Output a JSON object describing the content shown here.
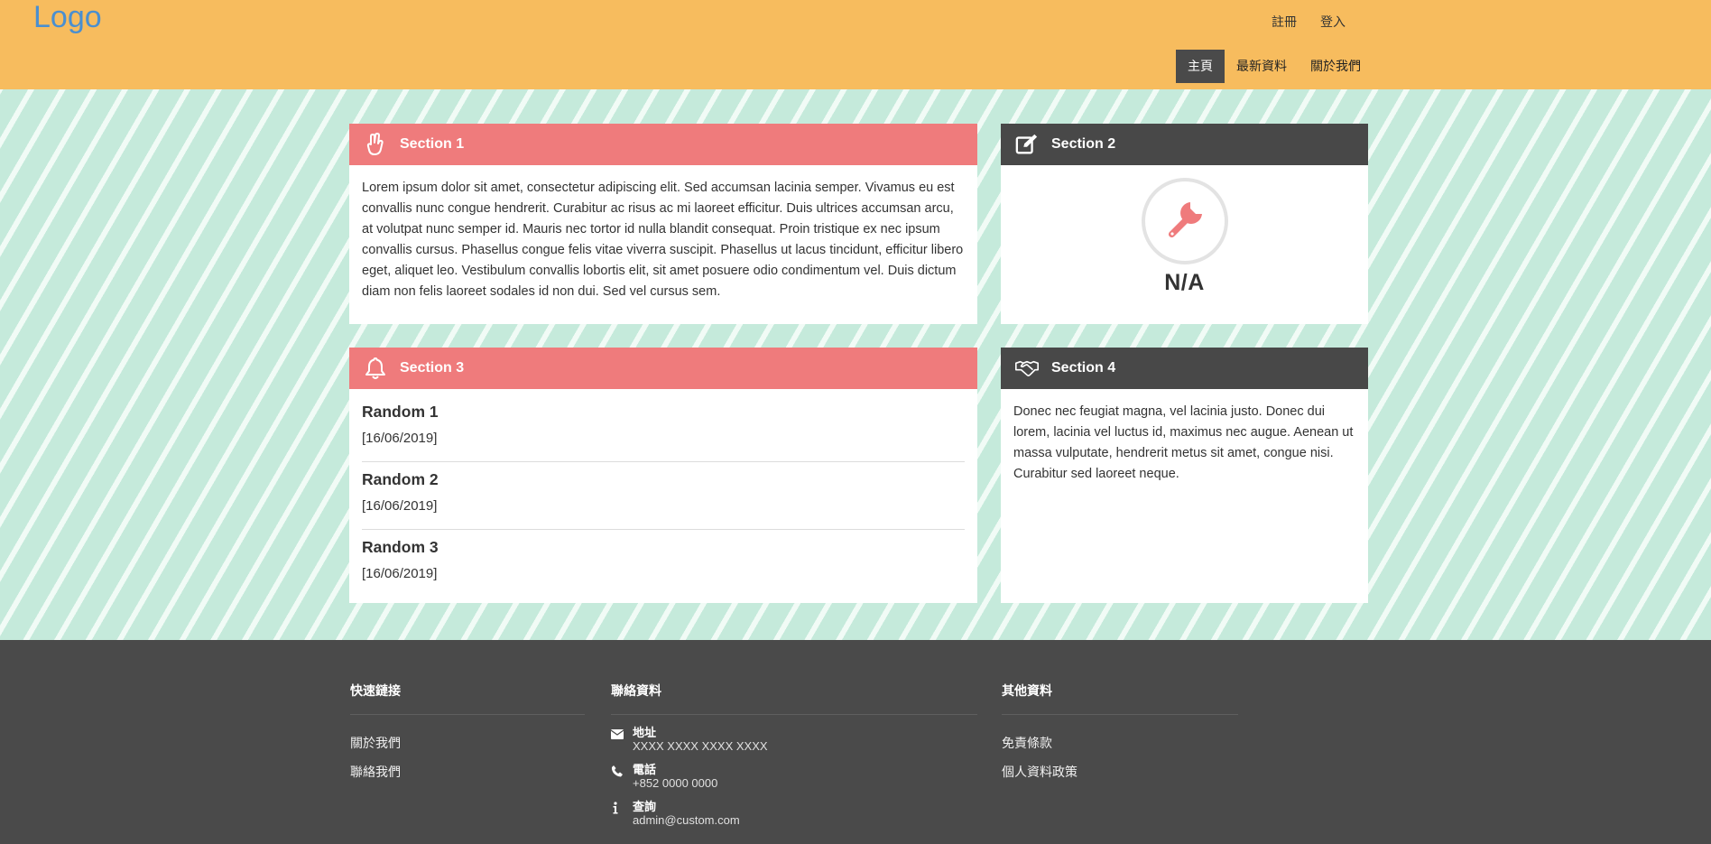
{
  "header": {
    "logo": "Logo",
    "top_links": [
      "註冊",
      "登入"
    ],
    "nav": [
      {
        "label": "主頁",
        "active": true
      },
      {
        "label": "最新資料",
        "active": false
      },
      {
        "label": "關於我們",
        "active": false
      }
    ]
  },
  "sections": {
    "s1": {
      "title": "Section 1",
      "icon": "hand-peace-icon",
      "body": "Lorem ipsum dolor sit amet, consectetur adipiscing elit. Sed accumsan lacinia semper. Vivamus eu est convallis nunc congue hendrerit. Curabitur ac risus ac mi laoreet efficitur. Duis ultrices accumsan arcu, at volutpat nunc semper id. Mauris nec tortor id nulla blandit consequat. Proin tristique ex nec ipsum convallis cursus. Phasellus congue felis vitae viverra suscipit. Phasellus ut lacus tincidunt, efficitur libero eget, aliquet leo. Vestibulum convallis lobortis elit, sit amet posuere odio condimentum vel. Duis dictum diam non felis laoreet sodales id non dui. Sed vel cursus sem."
    },
    "s2": {
      "title": "Section 2",
      "icon": "edit-icon",
      "status_icon": "wrench-icon",
      "value": "N/A"
    },
    "s3": {
      "title": "Section 3",
      "icon": "bell-icon",
      "items": [
        {
          "title": "Random 1",
          "date": "[16/06/2019]"
        },
        {
          "title": "Random 2",
          "date": "[16/06/2019]"
        },
        {
          "title": "Random 3",
          "date": "[16/06/2019]"
        }
      ]
    },
    "s4": {
      "title": "Section 4",
      "icon": "handshake-icon",
      "body": "Donec nec feugiat magna, vel lacinia justo. Donec dui lorem, lacinia vel luctus id, maximus nec augue. Aenean ut massa vulputate, hendrerit metus sit amet, congue nisi. Curabitur sed laoreet neque."
    }
  },
  "footer": {
    "quick_links": {
      "title": "快速鏈接",
      "links": [
        "關於我們",
        "聯絡我們"
      ]
    },
    "contact": {
      "title": "聯絡資料",
      "rows": [
        {
          "icon": "envelope-icon",
          "label": "地址",
          "value": "XXXX XXXX XXXX XXXX"
        },
        {
          "icon": "phone-icon",
          "label": "電話",
          "value": "+852 0000 0000"
        },
        {
          "icon": "info-icon",
          "label": "查詢",
          "value": "admin@custom.com"
        }
      ]
    },
    "other": {
      "title": "其他資料",
      "links": [
        "免責條款",
        "個人資料政策"
      ]
    }
  },
  "colors": {
    "header_bg": "#f7bc5e",
    "logo": "#4a8fd0",
    "accent_pink": "#ef7b7c",
    "dark": "#484848",
    "stripe_bg": "#c5eadb"
  }
}
